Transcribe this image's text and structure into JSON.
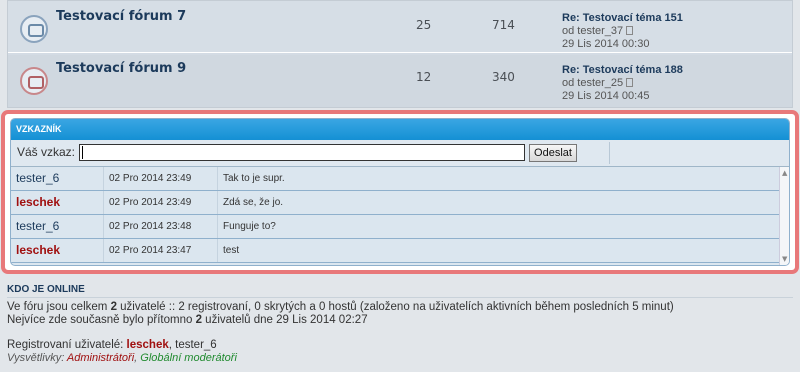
{
  "forums": [
    {
      "title": "Testovací fórum 7",
      "topics": "25",
      "posts": "714",
      "last_title": "Re: Testovací téma 151",
      "last_by": "od tester_37",
      "last_date": "29 Lis 2014 00:30",
      "icon": "forum-read-icon"
    },
    {
      "title": "Testovací fórum 9",
      "topics": "12",
      "posts": "340",
      "last_title": "Re: Testovací téma 188",
      "last_by": "od tester_25",
      "last_date": "29 Lis 2014 00:45",
      "icon": "forum-locked-icon"
    }
  ],
  "shoutbox": {
    "title": "VZKAZNÍK",
    "label": "Váš vzkaz:",
    "input_value": "",
    "submit": "Odeslat",
    "messages": [
      {
        "user": "tester_6",
        "time": "02 Pro 2014 23:49",
        "text": "Tak to je supr.",
        "admin": false
      },
      {
        "user": "leschek",
        "time": "02 Pro 2014 23:49",
        "text": "Zdá se, že jo.",
        "admin": true
      },
      {
        "user": "tester_6",
        "time": "02 Pro 2014 23:48",
        "text": "Funguje to?",
        "admin": false
      },
      {
        "user": "leschek",
        "time": "02 Pro 2014 23:47",
        "text": "test",
        "admin": true
      }
    ]
  },
  "online": {
    "title": "KDO JE ONLINE",
    "line1_a": "Ve fóru jsou celkem ",
    "line1_n": "2",
    "line1_b": " uživatelé :: 2 registrovaní, 0 skrytých a 0 hostů (založeno na uživatelích aktivních během posledních 5 minut)",
    "line2_a": "Nejvíce zde současně bylo přítomno ",
    "line2_n": "2",
    "line2_b": " uživatelů dne 29 Lis 2014 02:27",
    "registered_label": "Registrovaní uživatelé: ",
    "registered_admin": "leschek",
    "registered_rest": ", tester_6",
    "legend_label": "Vysvětlivky: ",
    "legend_admin": "Administrátoři",
    "legend_sep": ", ",
    "legend_global": "Globální moderátoři"
  },
  "colors": {
    "highlight": "#e8787a",
    "header": "#1490d4",
    "admin": "#a01010",
    "global_mod": "#1f8a2e"
  }
}
